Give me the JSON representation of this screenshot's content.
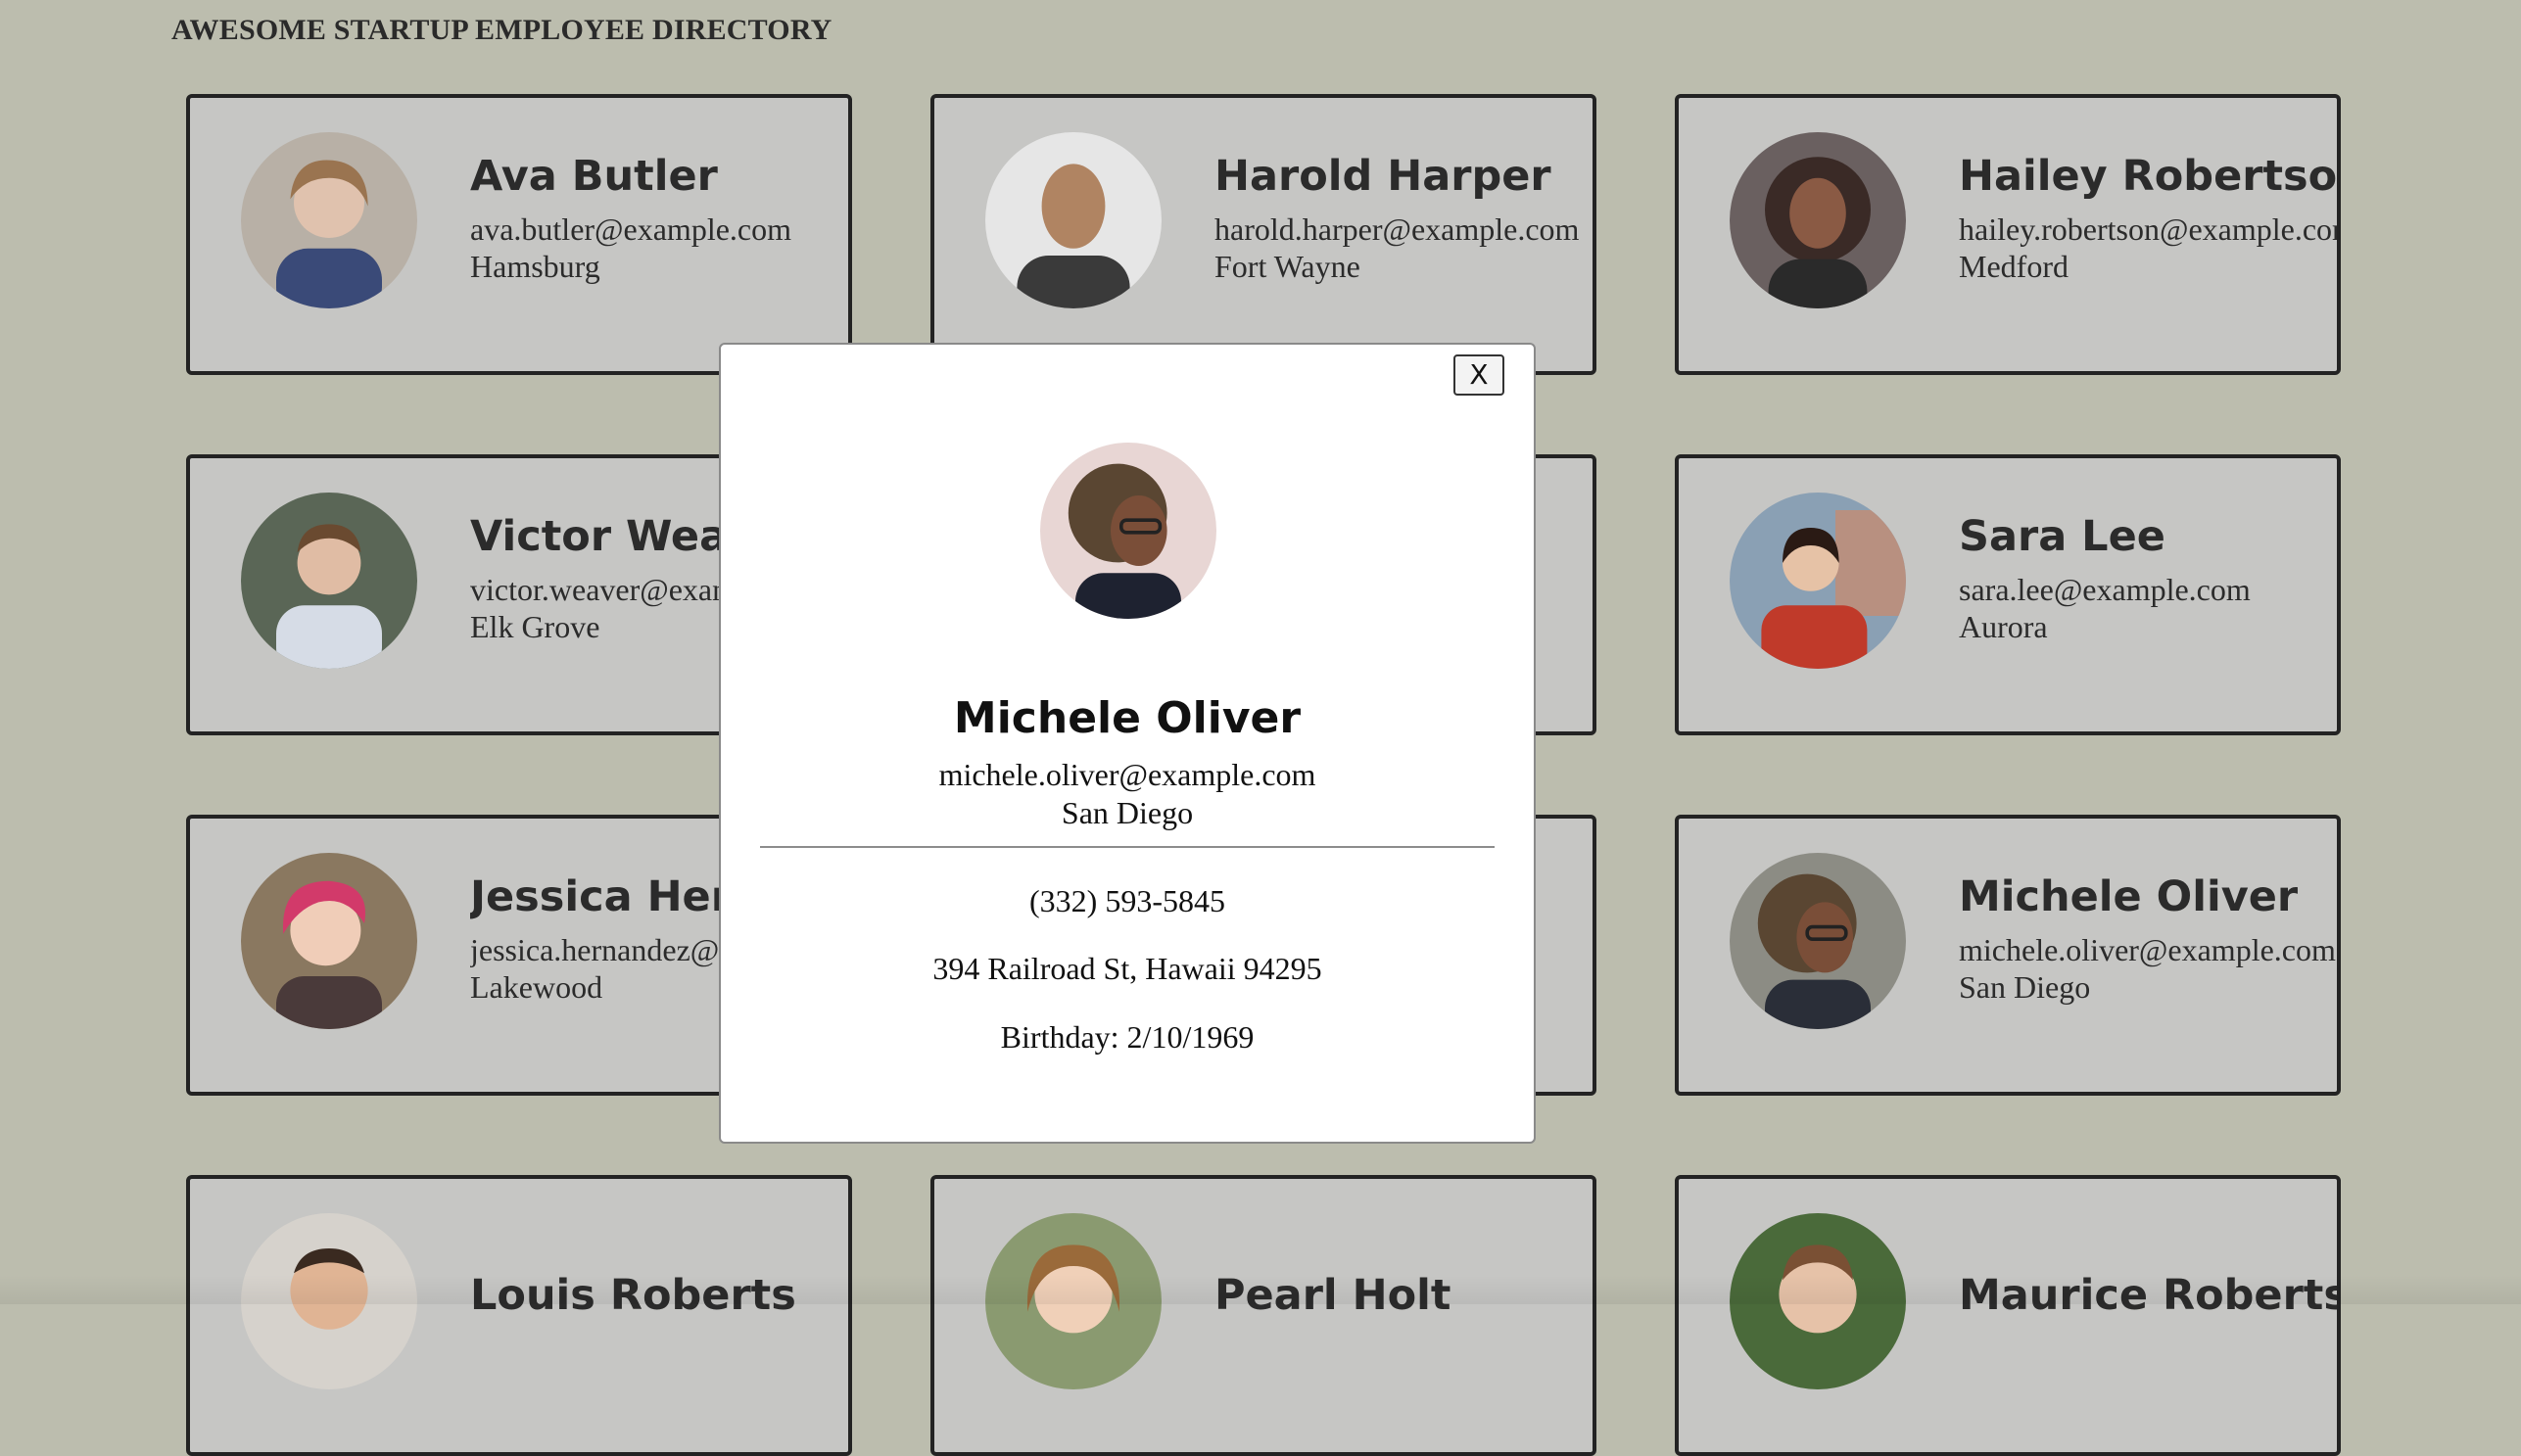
{
  "page": {
    "title": "AWESOME STARTUP EMPLOYEE DIRECTORY"
  },
  "colors": {
    "background": "#bcbdae",
    "card_background": "#c6c6c4",
    "card_border": "#232323",
    "modal_background": "#ffffff"
  },
  "employees": [
    {
      "name": "Ava Butler",
      "email": "ava.butler@example.com",
      "city": "Hamsburg",
      "avatar": "#8a7a6a"
    },
    {
      "name": "Harold Harper",
      "email": "harold.harper@example.com",
      "city": "Fort Wayne",
      "avatar": "#9a7a62"
    },
    {
      "name": "Hailey Robertson",
      "email": "hailey.robertson@example.com",
      "city": "Medford",
      "avatar": "#5a4038"
    },
    {
      "name": "Victor Weaver",
      "email": "victor.weaver@example.com",
      "city": "Elk Grove",
      "avatar": "#8c7868"
    },
    {
      "name": "",
      "email": "",
      "city": "",
      "avatar": "#888888"
    },
    {
      "name": "Sara Lee",
      "email": "sara.lee@example.com",
      "city": "Aurora",
      "avatar": "#a08070"
    },
    {
      "name": "Jessica Hernandez",
      "email": "jessica.hernandez@example.com",
      "city": "Lakewood",
      "avatar": "#c06070"
    },
    {
      "name": "",
      "email": "",
      "city": "",
      "avatar": "#888888"
    },
    {
      "name": "Michele Oliver",
      "email": "michele.oliver@example.com",
      "city": "San Diego",
      "avatar": "#6a5648"
    },
    {
      "name": "Louis Roberts",
      "email": "",
      "city": "",
      "avatar": "#9a8070"
    },
    {
      "name": "Pearl Holt",
      "email": "",
      "city": "",
      "avatar": "#a08868"
    },
    {
      "name": "Maurice Roberts",
      "email": "",
      "city": "",
      "avatar": "#6a7050"
    }
  ],
  "modal": {
    "close_label": "X",
    "name": "Michele Oliver",
    "email": "michele.oliver@example.com",
    "city": "San Diego",
    "phone": "(332) 593-5845",
    "address": "394 Railroad St, Hawaii 94295",
    "birthday": "Birthday: 2/10/1969"
  }
}
